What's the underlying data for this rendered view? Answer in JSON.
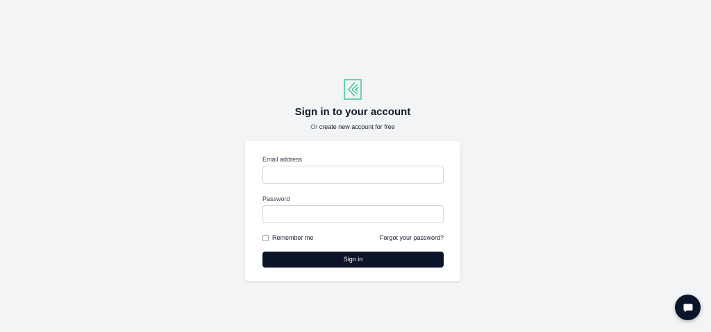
{
  "brand": {
    "logo_icon": "chevrons-left-logo-icon",
    "accent_color": "#34c38f"
  },
  "header": {
    "title": "Sign in to your account",
    "subtitle_prefix": "Or",
    "subtitle_link": "create new account for free"
  },
  "form": {
    "email_label": "Email address",
    "email_value": "",
    "email_placeholder": "",
    "password_label": "Password",
    "password_value": "",
    "password_placeholder": "",
    "remember_label": "Remember me",
    "remember_checked": false,
    "forgot_link": "Forgot your password?",
    "submit_label": "Sign in",
    "submit_color": "#0b1428"
  },
  "chat_widget": {
    "icon": "chat-bubble-icon"
  }
}
